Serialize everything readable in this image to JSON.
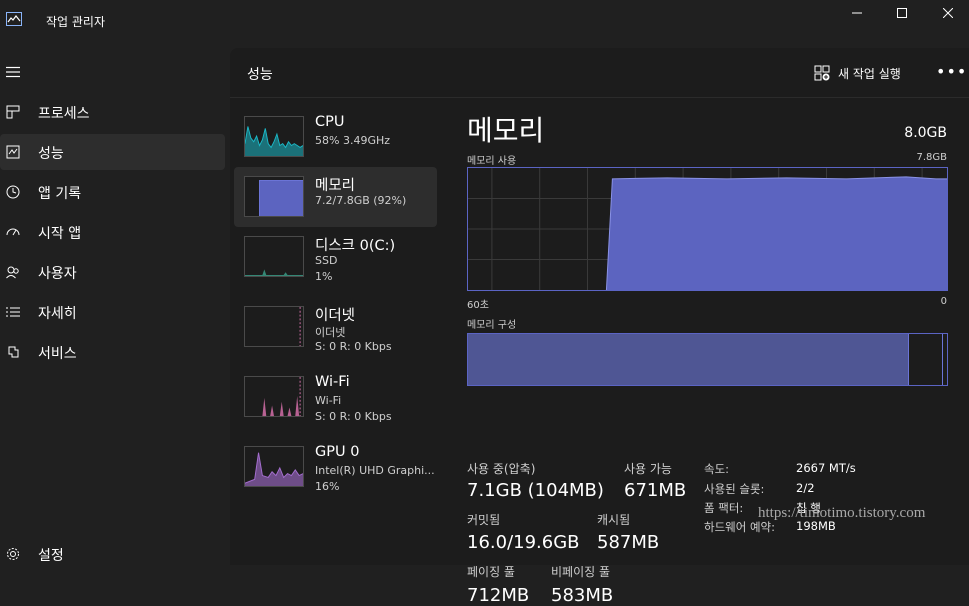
{
  "titlebar": {
    "title": "작업 관리자"
  },
  "nav": {
    "items": [
      {
        "label": "프로세스",
        "icon": "processes-icon"
      },
      {
        "label": "성능",
        "icon": "performance-icon"
      },
      {
        "label": "앱 기록",
        "icon": "app-history-icon"
      },
      {
        "label": "시작 앱",
        "icon": "startup-apps-icon"
      },
      {
        "label": "사용자",
        "icon": "users-icon"
      },
      {
        "label": "자세히",
        "icon": "details-icon"
      },
      {
        "label": "서비스",
        "icon": "services-icon"
      }
    ],
    "settings_label": "설정",
    "active": "성능"
  },
  "header": {
    "title": "성능",
    "run_task_label": "새 작업 실행",
    "more_label": "•••"
  },
  "devices": [
    {
      "name": "CPU",
      "line1": "58% 3.49GHz",
      "line2": "",
      "color": "#1bb8c6"
    },
    {
      "name": "메모리",
      "line1": "7.2/7.8GB (92%)",
      "line2": "",
      "color": "#6b74d6"
    },
    {
      "name": "디스크 0(C:)",
      "line1": "SSD",
      "line2": "1%",
      "color": "#3fb59b"
    },
    {
      "name": "이더넷",
      "line1": "이더넷",
      "line2": "S: 0 R: 0 Kbps",
      "color": "#d36fa8"
    },
    {
      "name": "Wi-Fi",
      "line1": "Wi-Fi",
      "line2": "S: 0 R: 0 Kbps",
      "color": "#d36fa8"
    },
    {
      "name": "GPU 0",
      "line1": "Intel(R) UHD Graphi...",
      "line2": "16%",
      "color": "#a56ed0"
    }
  ],
  "memory": {
    "title": "메모리",
    "total": "8.0GB",
    "usage_label": "메모리 사용",
    "usage_max": "7.8GB",
    "x_left": "60초",
    "x_right": "0",
    "composition_label": "메모리 구성",
    "usage_fraction": 0.92,
    "stats": {
      "in_use_label": "사용 중(압축)",
      "in_use": "7.1GB (104MB)",
      "available_label": "사용 가능",
      "available": "671MB",
      "committed_label": "커밋됨",
      "committed": "16.0/19.6GB",
      "cached_label": "캐시됨",
      "cached": "587MB",
      "paged_label": "페이징 풀",
      "paged": "712MB",
      "nonpaged_label": "비페이징 풀",
      "nonpaged": "583MB"
    },
    "props": [
      {
        "k": "속도:",
        "v": "2667 MT/s"
      },
      {
        "k": "사용된 슬롯:",
        "v": "2/2"
      },
      {
        "k": "폼 팩터:",
        "v": "칩 행"
      },
      {
        "k": "하드웨어 예약:",
        "v": "198MB"
      }
    ]
  },
  "watermark": "https://timotimo.tistory.com"
}
